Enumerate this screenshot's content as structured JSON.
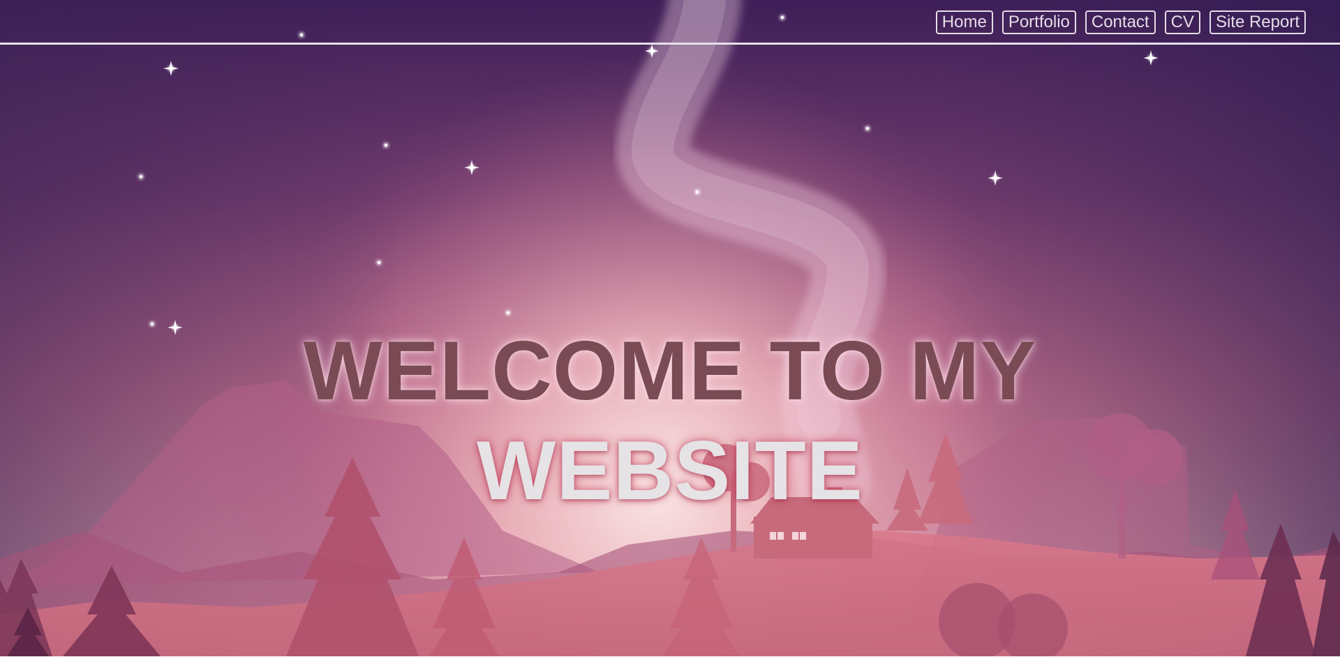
{
  "nav": {
    "items": [
      {
        "label": "Home"
      },
      {
        "label": "Portfolio"
      },
      {
        "label": "Contact"
      },
      {
        "label": "CV"
      },
      {
        "label": "Site Report"
      }
    ]
  },
  "hero": {
    "line1": "WELCOME TO MY",
    "line2": "WEBSITE"
  },
  "colors": {
    "sky_top": "#3e1f58",
    "sky_glow": "#f3d7d9",
    "hero_line1": "#7a4b55",
    "hero_line2": "#e6e3e6",
    "nav_border": "#e6dde8"
  },
  "icons": [
    "star-icon",
    "cabin-icon",
    "pine-tree-icon",
    "mountain-icon"
  ]
}
